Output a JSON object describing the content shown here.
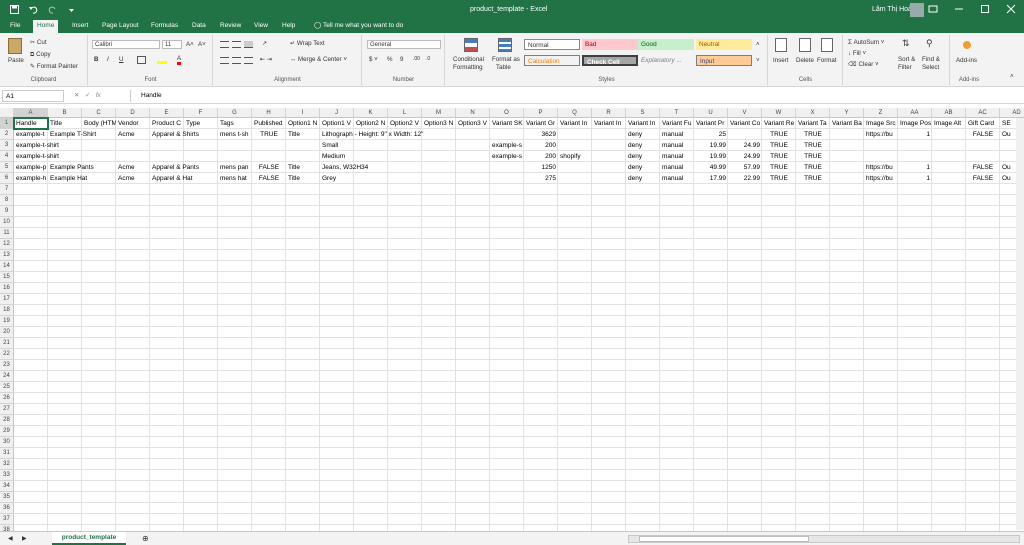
{
  "window": {
    "title": "product_template  -  Excel",
    "user": "Lâm Thị Hoài"
  },
  "ribbon_tabs": [
    "File",
    "Home",
    "Insert",
    "Page Layout",
    "Formulas",
    "Data",
    "Review",
    "View",
    "Help"
  ],
  "tell_me": "Tell me what you want to do",
  "clipboard": {
    "paste": "Paste",
    "cut": "Cut",
    "copy": "Copy",
    "format_painter": "Format Painter",
    "label": "Clipboard"
  },
  "font": {
    "name": "Calibri",
    "size": "11",
    "label": "Font"
  },
  "alignment": {
    "wrap": "Wrap Text",
    "merge": "Merge & Center",
    "label": "Alignment"
  },
  "number": {
    "format": "General",
    "label": "Number"
  },
  "styles": {
    "conditional": "Conditional",
    "formatting": "Formatting",
    "format_as": "Format as",
    "table": "Table",
    "normal": "Normal",
    "bad": "Bad",
    "good": "Good",
    "neutral": "Neutral",
    "calculation": "Calculation",
    "check_cell": "Check Cell",
    "explanatory": "Explanatory ...",
    "input": "Input",
    "label": "Styles"
  },
  "cells_group": {
    "insert": "Insert",
    "delete": "Delete",
    "format": "Format",
    "label": "Cells"
  },
  "editing": {
    "autosum": "AutoSum",
    "fill": "Fill",
    "clear": "Clear",
    "sort": "Sort &",
    "filter": "Filter",
    "find": "Find &",
    "select": "Select",
    "label": "Editing"
  },
  "addins": {
    "button": "Add-ins",
    "label": "Add-ins"
  },
  "formula_bar": {
    "name_box": "A1",
    "fx": "fx",
    "content": "Handle"
  },
  "columns": [
    "A",
    "B",
    "C",
    "D",
    "E",
    "F",
    "G",
    "H",
    "I",
    "J",
    "K",
    "L",
    "M",
    "N",
    "O",
    "P",
    "Q",
    "R",
    "S",
    "T",
    "U",
    "V",
    "W",
    "X",
    "Y",
    "Z",
    "AA",
    "AB",
    "AC",
    "AD"
  ],
  "rows": [
    "1",
    "2",
    "3",
    "4",
    "5",
    "6",
    "7",
    "8",
    "9",
    "10",
    "11",
    "12",
    "13",
    "14",
    "15",
    "16",
    "17",
    "18",
    "19",
    "20",
    "21",
    "22",
    "23",
    "24",
    "25",
    "26",
    "27",
    "28",
    "29",
    "30",
    "31",
    "32",
    "33",
    "34",
    "35",
    "36",
    "37",
    "38"
  ],
  "cells": {
    "r1": [
      "Handle",
      "Title",
      "Body (HTM",
      "Vendor",
      "Product C",
      "Type",
      "Tags",
      "Published",
      "Option1 N",
      "Option1 V",
      "Option2 N",
      "Option2 V",
      "Option3 N",
      "Option3 V",
      "Variant SK",
      "Variant Gr",
      "Variant In",
      "Variant In",
      "Variant In",
      "Variant Fu",
      "Variant Pr",
      "Variant Co",
      "Variant Re",
      "Variant Ta",
      "Variant Ba",
      "Image Src",
      "Image Pos",
      "Image Alt",
      "Gift Card",
      "SE"
    ],
    "r2": [
      "example-t",
      "Example T-Shirt",
      "",
      "Acme",
      "Apparel & Shirts",
      "",
      "mens t-sh",
      "TRUE",
      "Title",
      "Lithograph - Height: 9\" x Width: 12\"",
      "",
      "",
      "",
      "",
      "",
      "3629",
      "",
      "",
      "deny",
      "manual",
      "25",
      "",
      "TRUE",
      "TRUE",
      "",
      "https://bu",
      "1",
      "",
      "FALSE",
      "Ou"
    ],
    "r3": [
      "example-t-shirt",
      "",
      "",
      "",
      "",
      "",
      "",
      "",
      "",
      "Small",
      "",
      "",
      "",
      "",
      "example-s",
      "200",
      "",
      "",
      "deny",
      "manual",
      "19.99",
      "24.99",
      "TRUE",
      "TRUE",
      "",
      "",
      "",
      "",
      "",
      ""
    ],
    "r4": [
      "example-t-shirt",
      "",
      "",
      "",
      "",
      "",
      "",
      "",
      "",
      "Medium",
      "",
      "",
      "",
      "",
      "example-s",
      "200",
      "shopify",
      "",
      "deny",
      "manual",
      "19.99",
      "24.99",
      "TRUE",
      "TRUE",
      "",
      "",
      "",
      "",
      "",
      ""
    ],
    "r5": [
      "example-p",
      "Example Pants",
      "",
      "Acme",
      "Apparel & Pants",
      "",
      "mens pan",
      "FALSE",
      "Title",
      "Jeans, W32H34",
      "",
      "",
      "",
      "",
      "",
      "1250",
      "",
      "",
      "deny",
      "manual",
      "49.99",
      "57.99",
      "TRUE",
      "TRUE",
      "",
      "https://bu",
      "1",
      "",
      "FALSE",
      "Ou"
    ],
    "r6": [
      "example-h",
      "Example Hat",
      "",
      "Acme",
      "Apparel & Hat",
      "",
      "mens hat",
      "FALSE",
      "Title",
      "Grey",
      "",
      "",
      "",
      "",
      "",
      "275",
      "",
      "",
      "deny",
      "manual",
      "17.99",
      "22.99",
      "TRUE",
      "TRUE",
      "",
      "https://bu",
      "1",
      "",
      "FALSE",
      "Ou"
    ]
  },
  "sheet_tab": "product_template"
}
